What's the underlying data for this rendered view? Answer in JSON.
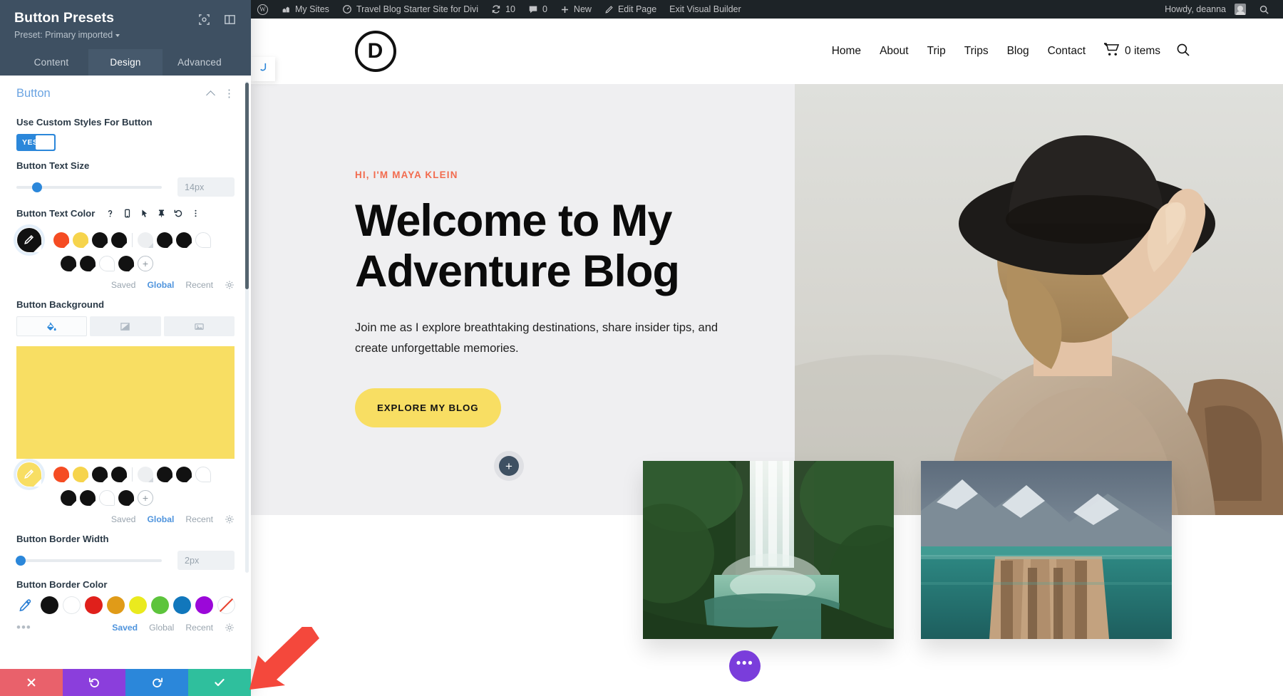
{
  "adminbar": {
    "wp_logo": "wordpress-logo-icon",
    "items": [
      {
        "label": "My Sites",
        "icon": "sites-icon"
      },
      {
        "label": "Travel Blog Starter Site for Divi",
        "icon": "dashboard-icon"
      },
      {
        "label": "10",
        "icon": "updates-icon"
      },
      {
        "label": "0",
        "icon": "comments-icon"
      },
      {
        "label": "New",
        "icon": "plus-icon"
      },
      {
        "label": "Edit Page",
        "icon": "pencil-icon"
      },
      {
        "label": "Exit Visual Builder",
        "icon": ""
      }
    ],
    "howdy": "Howdy, deanna",
    "search_icon": "search-icon"
  },
  "panel": {
    "title": "Button Presets",
    "preset_label": "Preset: Primary imported",
    "header_icons": [
      "focus-target-icon",
      "layout-columns-icon"
    ],
    "tabs": [
      {
        "label": "Content",
        "active": false
      },
      {
        "label": "Design",
        "active": true
      },
      {
        "label": "Advanced",
        "active": false
      }
    ],
    "section": {
      "title": "Button",
      "collapse_icon": "chevron-up-icon",
      "more_icon": "dots-vertical-icon"
    },
    "fields": {
      "custom_styles": {
        "label": "Use Custom Styles For Button",
        "toggle_value": "YES"
      },
      "text_size": {
        "label": "Button Text Size",
        "value": "14px",
        "slider_percent": 14
      },
      "text_color": {
        "label": "Button Text Color",
        "icons": [
          "help-icon",
          "responsive-icon",
          "hover-icon",
          "sticky-pin-icon",
          "reset-icon",
          "dots-vertical-icon"
        ],
        "picker_color": "#111111",
        "row1": [
          "#F54C23",
          "#F6D44C",
          "#121212",
          "#111111",
          "|",
          "#EDEFF1",
          "#121212",
          "#111111",
          "#FFFFFF"
        ],
        "row2": [
          "#121212",
          "#111111",
          "#FFFFFF",
          "#121212",
          "+"
        ],
        "tabs": [
          "Saved",
          "Global",
          "Recent"
        ],
        "active_tab": "Global",
        "gear_icon": "gear-icon"
      },
      "background": {
        "label": "Button Background",
        "tabs": [
          {
            "icon": "paint-bucket-icon",
            "active": true
          },
          {
            "icon": "gradient-icon",
            "active": false
          },
          {
            "icon": "image-icon",
            "active": false
          }
        ],
        "preview_color": "#F8DE63",
        "picker_color": "#F8DE63",
        "row1": [
          "#F54C23",
          "#F6D44C",
          "#121212",
          "#111111",
          "|",
          "#EDEFF1",
          "#121212",
          "#111111",
          "#FFFFFF"
        ],
        "row2": [
          "#121212",
          "#111111",
          "#FFFFFF",
          "#121212",
          "+"
        ],
        "tabs_lower": [
          "Saved",
          "Global",
          "Recent"
        ],
        "active_tab": "Global",
        "gear_icon": "gear-icon"
      },
      "border_width": {
        "label": "Button Border Width",
        "value": "2px",
        "slider_percent": 2
      },
      "border_color": {
        "label": "Button Border Color",
        "eyedropper_icon": "eyedropper-icon",
        "swatches": [
          "#111111",
          "#FFFFFF",
          "#E0201B",
          "#E09B18",
          "#EAEA1E",
          "#5DC43C",
          "#1177BC",
          "#9B08D9",
          "none"
        ],
        "more_icon": "dots-horizontal-icon",
        "tabs": [
          "Saved",
          "Global",
          "Recent"
        ],
        "active_tab": "Saved",
        "gear_icon": "gear-icon"
      }
    },
    "actions": [
      {
        "name": "cancel",
        "icon": "close-icon",
        "color": "#e9616b"
      },
      {
        "name": "undo",
        "icon": "undo-icon",
        "color": "#8b3edc"
      },
      {
        "name": "redo",
        "icon": "redo-icon",
        "color": "#2b87da"
      },
      {
        "name": "save",
        "icon": "check-icon",
        "color": "#2fbf9d"
      }
    ]
  },
  "site": {
    "logo_letter": "D",
    "nav": [
      "Home",
      "About",
      "Trip",
      "Trips",
      "Blog",
      "Contact"
    ],
    "cart_label": "0 items",
    "cart_icon": "cart-icon",
    "search_icon": "search-icon",
    "hero": {
      "eyebrow": "HI, I'M MAYA KLEIN",
      "heading_line1": "Welcome to My",
      "heading_line2": "Adventure Blog",
      "paragraph": "Join me as I explore breathtaking destinations, share insider tips, and create unforgettable memories.",
      "cta": "EXPLORE MY BLOG"
    },
    "add_section_icon": "plus-icon",
    "fab_icon": "dots-horizontal-icon",
    "left_tab_icon": "divi-toggle-icon"
  }
}
